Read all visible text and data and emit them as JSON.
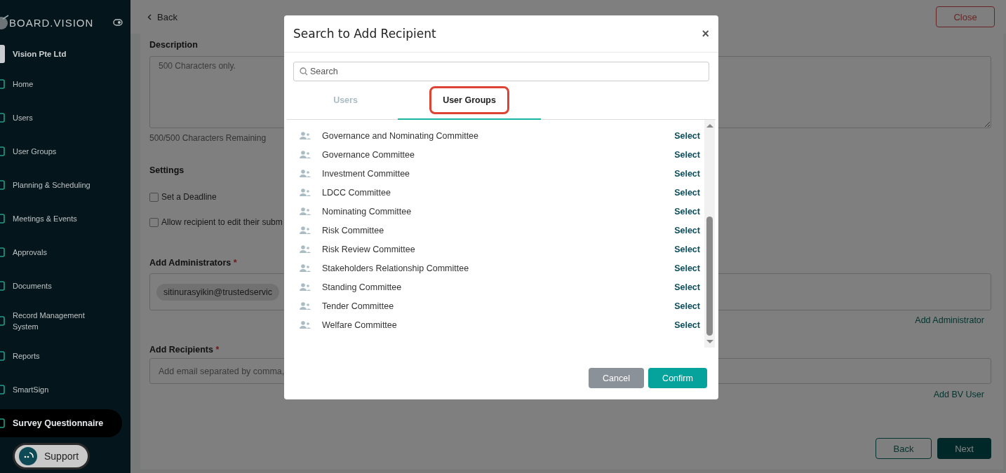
{
  "sidebar": {
    "brand": "BOARD.VISION",
    "organization": "Vision Pte Ltd",
    "items": [
      {
        "label": "Home",
        "selected": false
      },
      {
        "label": "Users",
        "selected": false
      },
      {
        "label": "User Groups",
        "selected": false
      },
      {
        "label": "Planning & Scheduling",
        "selected": false
      },
      {
        "label": "Meetings & Events",
        "selected": false
      },
      {
        "label": "Approvals",
        "selected": false
      },
      {
        "label": "Documents",
        "selected": false
      },
      {
        "label": "Record Management System",
        "selected": false
      },
      {
        "label": "Reports",
        "selected": false
      },
      {
        "label": "SmartSign",
        "selected": false
      },
      {
        "label": "Survey Questionnaire",
        "selected": true
      }
    ],
    "support": "Support"
  },
  "header": {
    "back": "Back",
    "close": "Close"
  },
  "form": {
    "description_label": "Description",
    "description_placeholder": "500 Characters only.",
    "remaining": "500/500 Characters Remaining",
    "settings_label": "Settings",
    "settings": [
      {
        "label": "Set a Deadline",
        "checked": false
      },
      {
        "label": "Allow recipient to edit their subm",
        "checked": false
      }
    ],
    "administrators_label": "Add Administrators",
    "administrators_required": "*",
    "administrator_chip": "sitinurasyikin@trustedservic",
    "add_administrator": "Add Administrator",
    "recipients_label": "Add Recipients",
    "recipients_required": "*",
    "recipients_placeholder": "Add email separated by comma,",
    "add_bv_user": "Add BV User",
    "back": "Back",
    "next": "Next"
  },
  "dialog": {
    "title": "Search to Add Recipient",
    "close": "×",
    "search_placeholder": "Search",
    "tabs": [
      {
        "label": "Users",
        "selected": false,
        "highlighted": false
      },
      {
        "label": "User Groups",
        "selected": true,
        "highlighted": true
      }
    ],
    "rows": [
      {
        "name": "Governance and Nominating Committee",
        "action": "Select"
      },
      {
        "name": "Governance Committee",
        "action": "Select"
      },
      {
        "name": "Investment Committee",
        "action": "Select"
      },
      {
        "name": "LDCC Committee",
        "action": "Select"
      },
      {
        "name": "Nominating Committee",
        "action": "Select"
      },
      {
        "name": "Risk Committee",
        "action": "Select"
      },
      {
        "name": "Risk Review Committee",
        "action": "Select"
      },
      {
        "name": "Stakeholders Relationship Committee",
        "action": "Select"
      },
      {
        "name": "Standing Committee",
        "action": "Select"
      },
      {
        "name": "Tender Committee",
        "action": "Select"
      },
      {
        "name": "Welfare Committee",
        "action": "Select"
      }
    ],
    "cancel": "Cancel",
    "confirm": "Confirm"
  }
}
